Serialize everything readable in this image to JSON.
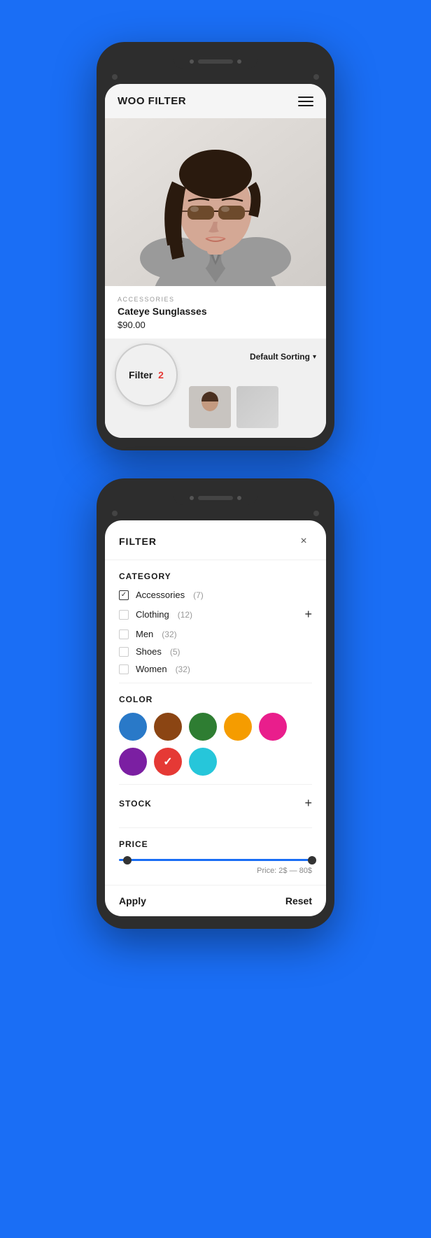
{
  "background_color": "#1a6ef5",
  "phone1": {
    "header": {
      "title": "WOO FILTER",
      "menu_label": "hamburger-menu"
    },
    "product": {
      "category": "ACCESSORIES",
      "name": "Cateye Sunglasses",
      "price": "$90.00"
    },
    "filter_bar": {
      "filter_label": "Filter",
      "filter_count": "2",
      "sort_label": "Default Sorting"
    }
  },
  "phone2": {
    "modal": {
      "title": "FILTER",
      "close_label": "×"
    },
    "category": {
      "section_title": "CATEGORY",
      "items": [
        {
          "name": "Accessories",
          "count": "(7)",
          "checked": true
        },
        {
          "name": "Clothing",
          "count": "(12)",
          "checked": false,
          "has_expand": true
        },
        {
          "name": "Men",
          "count": "(32)",
          "checked": false
        },
        {
          "name": "Shoes",
          "count": "(5)",
          "checked": false
        },
        {
          "name": "Women",
          "count": "(32)",
          "checked": false
        }
      ]
    },
    "color": {
      "section_title": "COLOR",
      "swatches": [
        {
          "color": "#2979c8",
          "selected": false,
          "name": "blue"
        },
        {
          "color": "#8B4513",
          "selected": false,
          "name": "brown"
        },
        {
          "color": "#2e7d32",
          "selected": false,
          "name": "green"
        },
        {
          "color": "#f59c00",
          "selected": false,
          "name": "yellow"
        },
        {
          "color": "#e91e8c",
          "selected": false,
          "name": "pink"
        },
        {
          "color": "#7b1fa2",
          "selected": false,
          "name": "purple"
        },
        {
          "color": "#e53935",
          "selected": true,
          "name": "red"
        },
        {
          "color": "#26c6da",
          "selected": false,
          "name": "teal"
        }
      ]
    },
    "stock": {
      "section_title": "STOCK"
    },
    "price": {
      "section_title": "PRICE",
      "label": "Price: 2$ — 80$",
      "min": 2,
      "max": 80
    },
    "footer": {
      "apply_label": "Apply",
      "reset_label": "Reset"
    }
  }
}
